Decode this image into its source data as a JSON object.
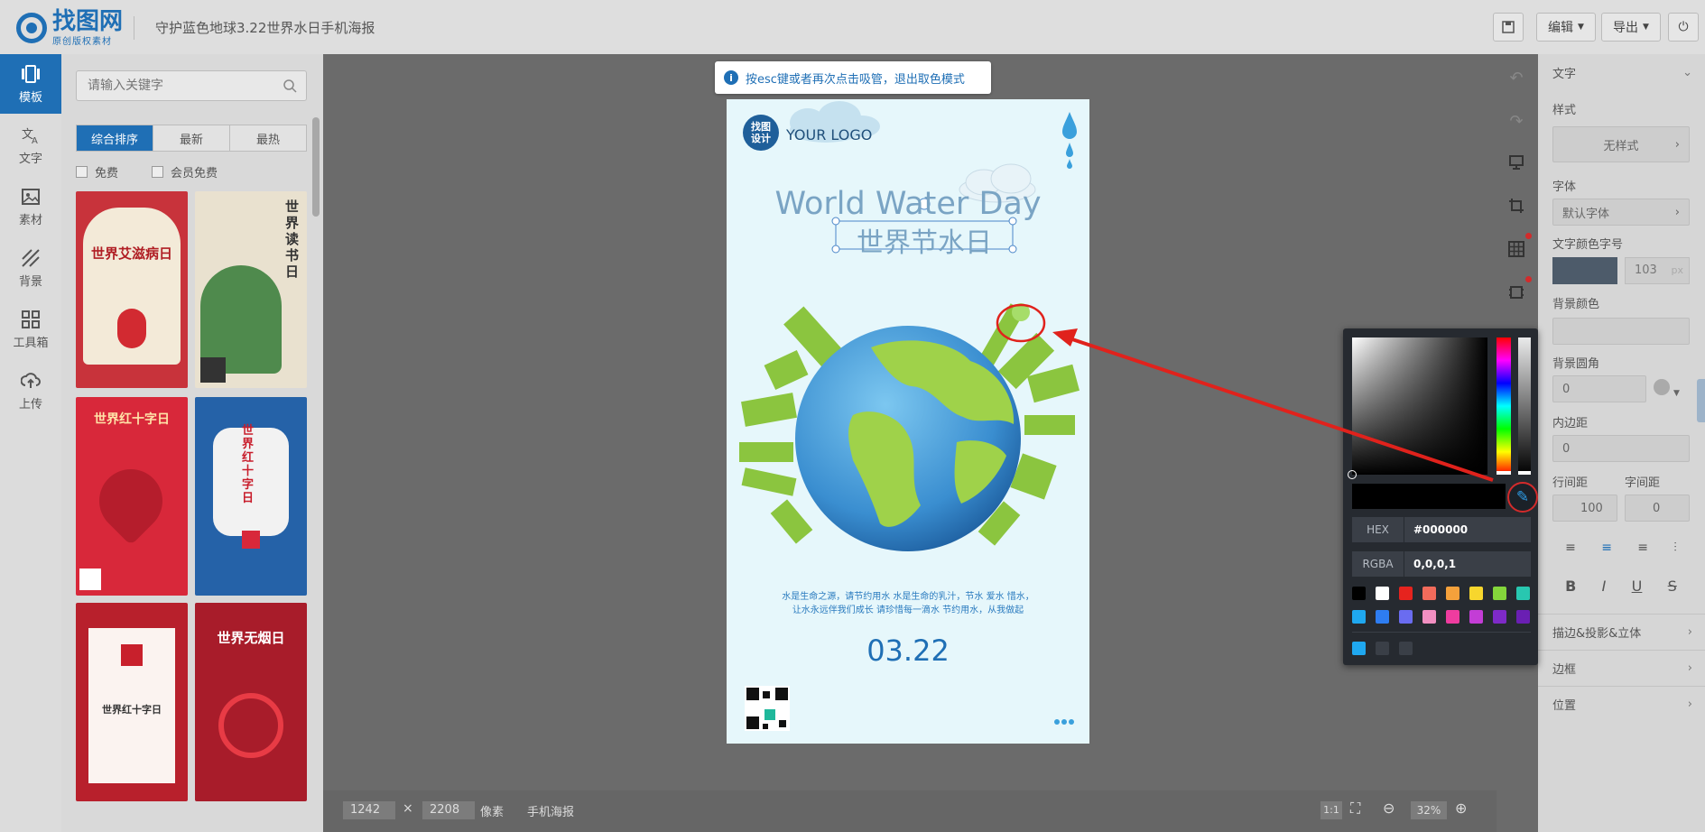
{
  "app": {
    "logo_text": "找图网",
    "logo_sub": "原创版权素材",
    "doc_title": "守护蓝色地球3.22世界水日手机海报"
  },
  "toolbar": {
    "edit_label": "编辑",
    "export_label": "导出"
  },
  "rail": {
    "items": [
      {
        "label": "模板",
        "icon": "template-icon"
      },
      {
        "label": "文字",
        "icon": "text-icon"
      },
      {
        "label": "素材",
        "icon": "image-icon"
      },
      {
        "label": "背景",
        "icon": "background-icon"
      },
      {
        "label": "工具箱",
        "icon": "toolbox-icon"
      },
      {
        "label": "上传",
        "icon": "upload-icon"
      }
    ]
  },
  "panel": {
    "search_placeholder": "请输入关键字",
    "sort_tabs": [
      "综合排序",
      "最新",
      "最热"
    ],
    "filters": [
      "免费",
      "会员免费"
    ],
    "thumbs": [
      {
        "title": "世界艾滋病日",
        "bg": "#c8333b"
      },
      {
        "title": "世界读书日",
        "bg": "#e9e1cf"
      },
      {
        "title": "世界红十字日",
        "bg": "#d8283a"
      },
      {
        "title": "世界红十字日",
        "bg": "#2562a8"
      },
      {
        "title": "世界红十字日",
        "bg": "#b8202c"
      },
      {
        "title": "世界无烟日",
        "bg": "#a81c2a"
      }
    ]
  },
  "canvas": {
    "esc_tip": "按esc键或者再次点击吸管，退出取色模式",
    "poster": {
      "logo_mark": "找图\n设计",
      "logo_text": "YOUR LOGO",
      "title_en": "World Water Day",
      "title_zh": "世界节水日",
      "body_line1": "水是生命之源，请节约用水 水是生命的乳汁，节水 爱水 惜水，",
      "body_line2": "让水永远伴我们成长 请珍惜每一滴水 节约用水，从我做起",
      "date": "03.22"
    }
  },
  "bottombar": {
    "width": "1242",
    "times": "×",
    "height": "2208",
    "unit": "像素",
    "preset": "手机海报",
    "ratio_label": "1:1",
    "zoom": "32%"
  },
  "picker": {
    "hex_label": "HEX",
    "hex_value": "#000000",
    "rgba_label": "RGBA",
    "rgba_value": "0,0,0,1",
    "swatches": [
      "#000000",
      "#ffffff",
      "#e6231e",
      "#f26b5b",
      "#f5a13b",
      "#f7d62d",
      "#84d63b",
      "#28c7b0",
      "#1fa8f0",
      "#2e7df1",
      "#6a6cf0",
      "#f28fc1",
      "#ef3c9f",
      "#c33dd6",
      "#7e2ac7",
      "#6a1fb3"
    ],
    "recent": [
      "#1fa8f0",
      "#3a3f47",
      "#3a3f47"
    ]
  },
  "props": {
    "section_text": "文字",
    "style_label": "样式",
    "style_value": "无样式",
    "font_label": "字体",
    "font_value": "默认字体",
    "color_size_label": "文字颜色字号",
    "font_size": "103",
    "px": "px",
    "bg_color_label": "背景颜色",
    "radius_label": "背景圆角",
    "radius_value": "0",
    "padding_label": "内边距",
    "padding_value": "0",
    "line_height_label": "行间距",
    "line_height_value": "100",
    "letter_spacing_label": "字间距",
    "letter_spacing_value": "0",
    "sections": [
      "描边&投影&立体",
      "边框",
      "位置"
    ]
  }
}
